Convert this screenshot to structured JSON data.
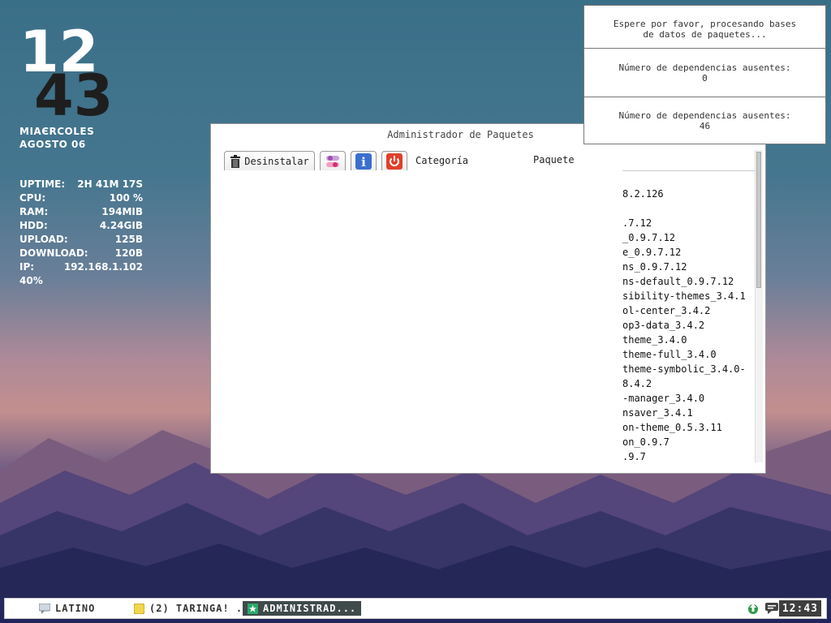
{
  "desktop": {
    "clock_widget": {
      "hours": "12",
      "minutes": "43"
    },
    "date": {
      "weekday": "MIAЄRCOLES",
      "month_day": "AGOSTO 06"
    },
    "stats": [
      {
        "label": "UPTIME:",
        "value": "2H 41M 17S"
      },
      {
        "label": "CPU:",
        "value": "100 %"
      },
      {
        "label": "RAM:",
        "value": "194MIB"
      },
      {
        "label": "HDD:",
        "value": "4.24GIB"
      },
      {
        "label": "UPLOAD:",
        "value": "125B"
      },
      {
        "label": "DOWNLOAD:",
        "value": "120B"
      },
      {
        "label": "IP:",
        "value": "192.168.1.102"
      },
      {
        "label": "40%",
        "value": ""
      }
    ]
  },
  "package_manager": {
    "title": "Administrador de Paquetes",
    "toolbar": {
      "uninstall_label": "Desinstalar",
      "icons": [
        "toggle-icon",
        "info-icon",
        "power-icon"
      ]
    },
    "columns": {
      "category": "Categoría",
      "package": "Paquete"
    },
    "packages": [
      "8.2.126",
      "",
      ".7.12",
      "_0.9.7.12",
      "e_0.9.7.12",
      "ns_0.9.7.12",
      "ns-default_0.9.7.12",
      "sibility-themes_3.4.1",
      "ol-center_3.4.2",
      "op3-data_3.4.2",
      "theme_3.4.0",
      "theme-full_3.4.0",
      "theme-symbolic_3.4.0-",
      "8.4.2",
      "-manager_3.4.0",
      "nsaver_3.4.1",
      "on-theme_0.5.3.11",
      "on_0.9.7",
      ".9.7"
    ]
  },
  "notifications": [
    {
      "text": "Espere por favor, procesando bases\nde datos de paquetes..."
    },
    {
      "text": "Número de dependencias ausentes:\n0"
    },
    {
      "text": "Número de dependencias ausentes:\n46"
    }
  ],
  "taskbar": {
    "items": [
      {
        "label": "LATINO",
        "icon": "chat-icon"
      },
      {
        "label": "(2) TARINGA! ...",
        "icon": "browser-icon"
      },
      {
        "label": "ADMINISTRAD...",
        "icon": "star-icon"
      }
    ],
    "tray_icons": [
      "update-icon",
      "message-icon"
    ],
    "clock": "12:43"
  }
}
